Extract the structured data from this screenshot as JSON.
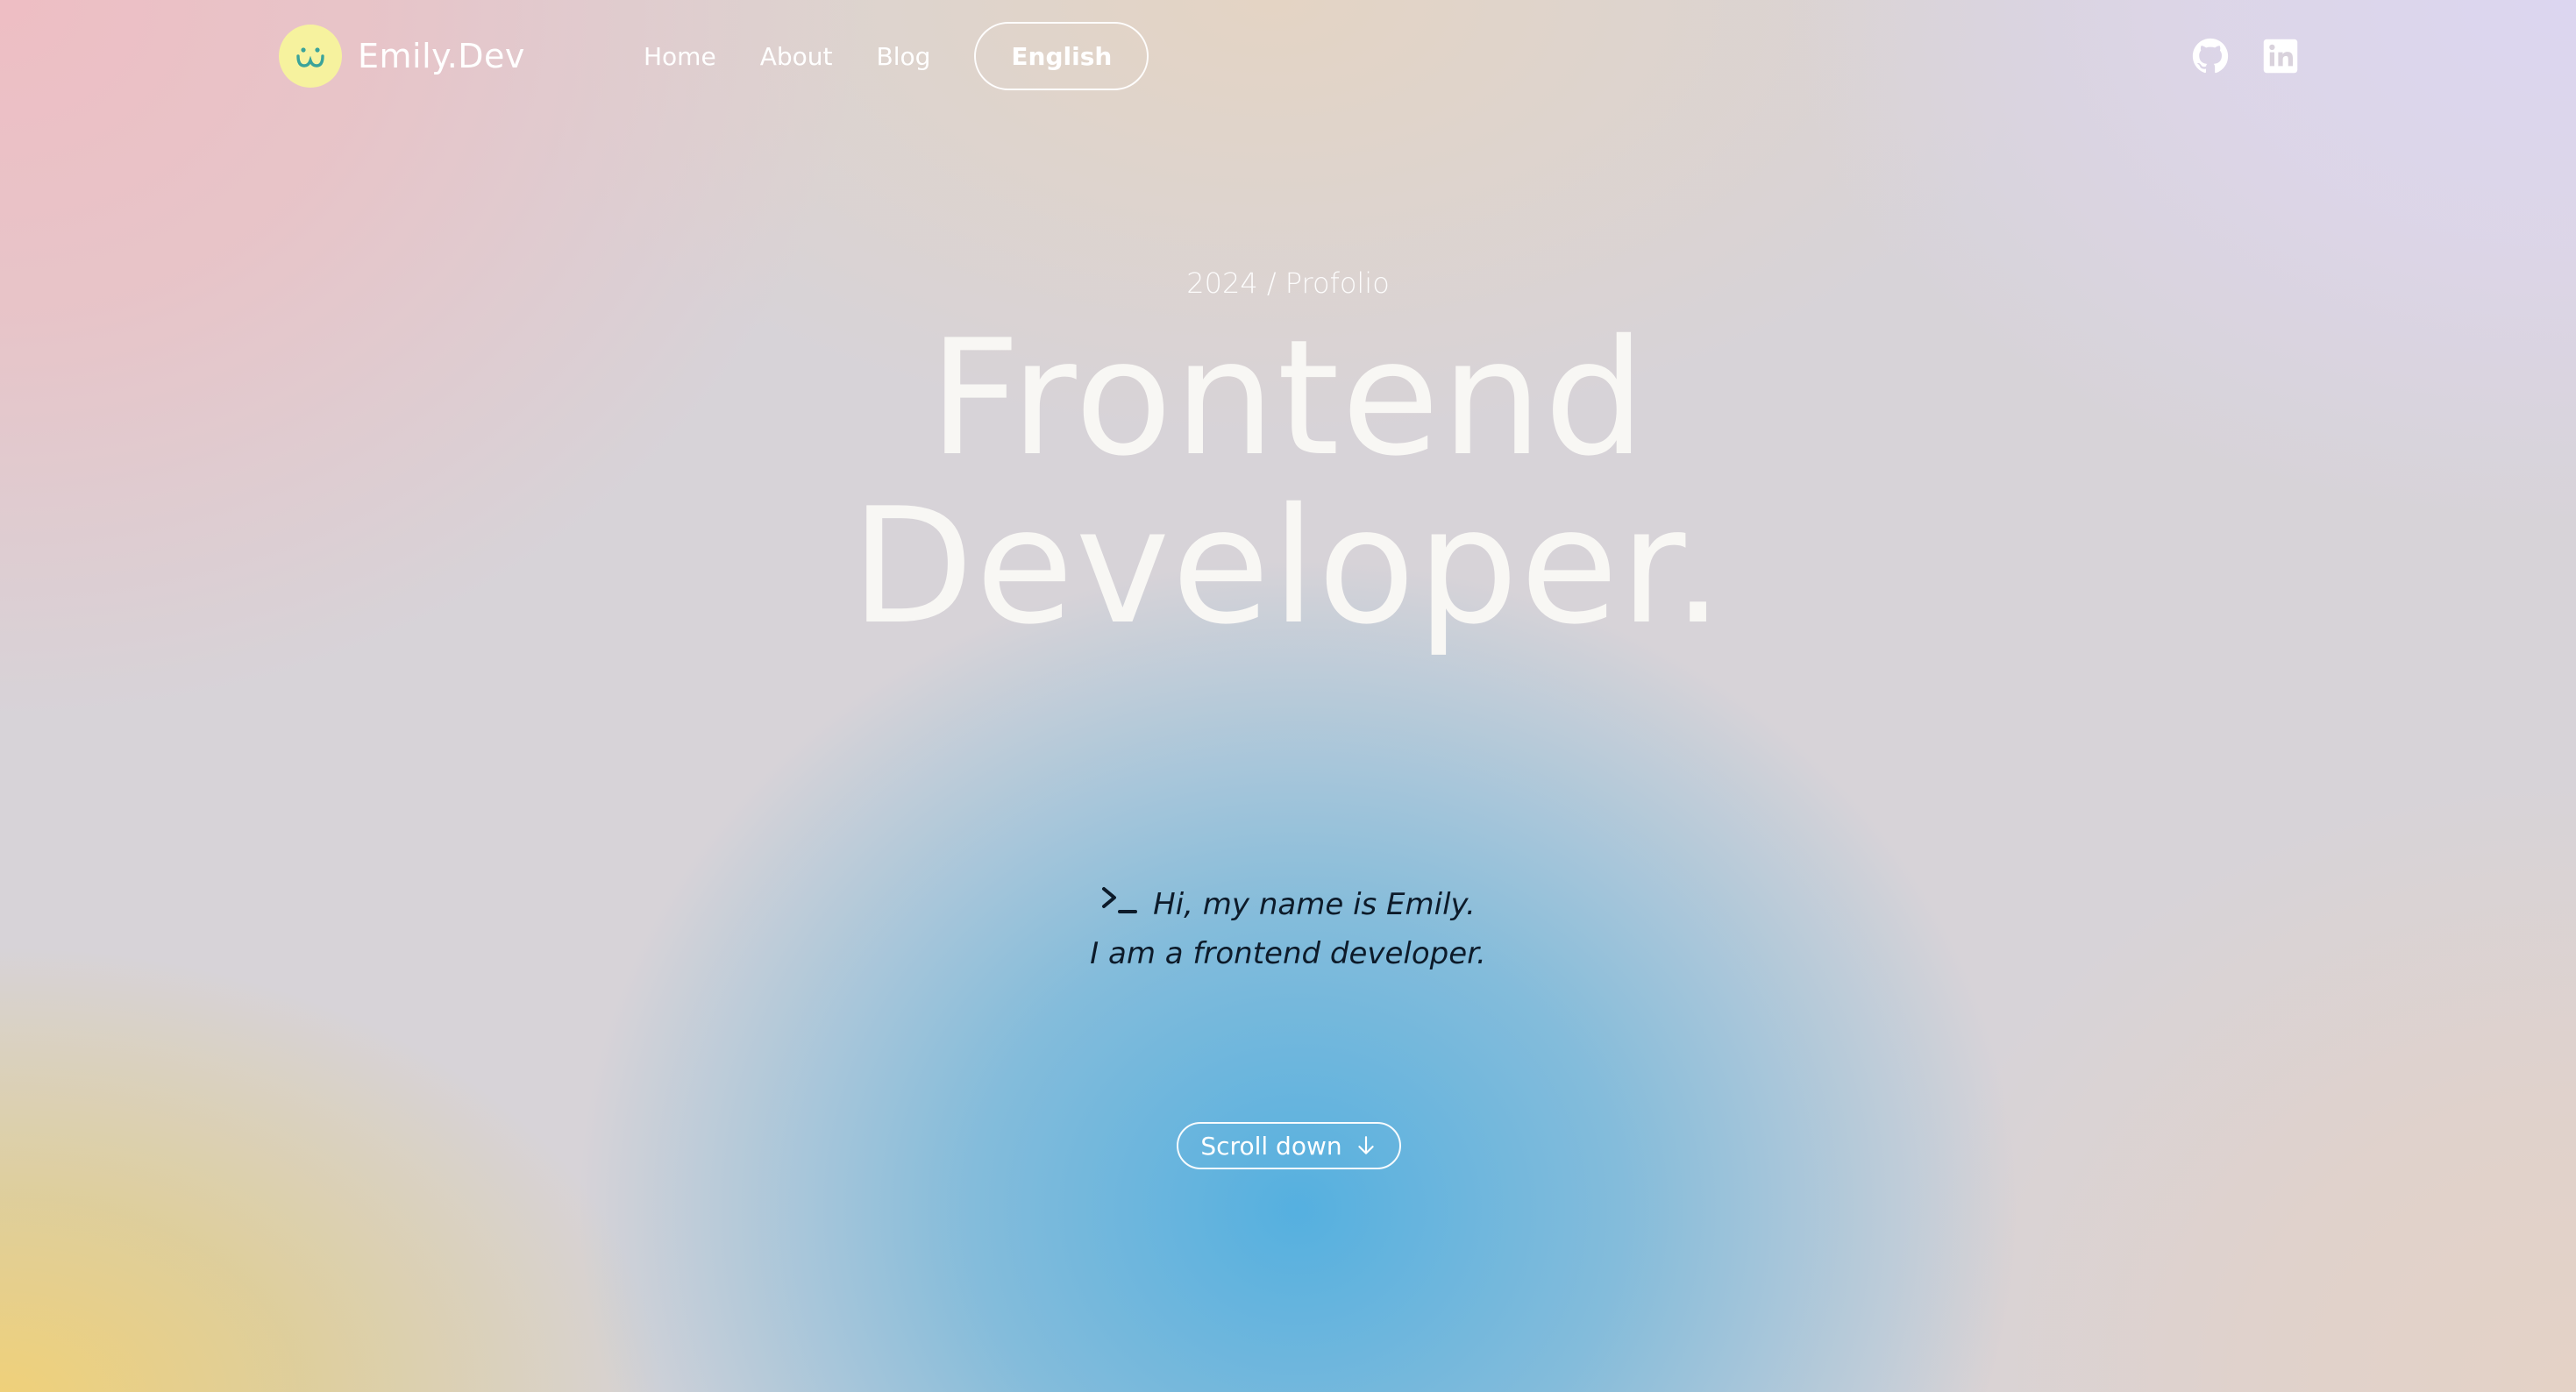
{
  "brand": {
    "name": "Emily.Dev",
    "logo_icon": "smiley-face-icon",
    "logo_color": "#f6f29e"
  },
  "nav": {
    "items": [
      {
        "label": "Home"
      },
      {
        "label": "About"
      },
      {
        "label": "Blog"
      }
    ],
    "language_button": "English"
  },
  "socials": [
    {
      "icon": "github-icon"
    },
    {
      "icon": "linkedin-icon"
    }
  ],
  "hero": {
    "eyebrow": "2024 / Profolio",
    "headline_line1": "Frontend",
    "headline_line2": "Developer.",
    "intro_line1": "Hi, my name is Emily.",
    "intro_line2": "I am a frontend developer.",
    "intro_icon": "terminal-prompt-icon",
    "scroll_label": "Scroll down",
    "scroll_icon": "arrow-down-icon"
  },
  "colors": {
    "text_light": "#ffffff",
    "text_dark": "#0d1b2a",
    "gradient_blue": "#4eaee0",
    "gradient_pink": "#eebec4",
    "gradient_yellow": "#f0d078",
    "gradient_lavender": "#dcd6f0"
  }
}
